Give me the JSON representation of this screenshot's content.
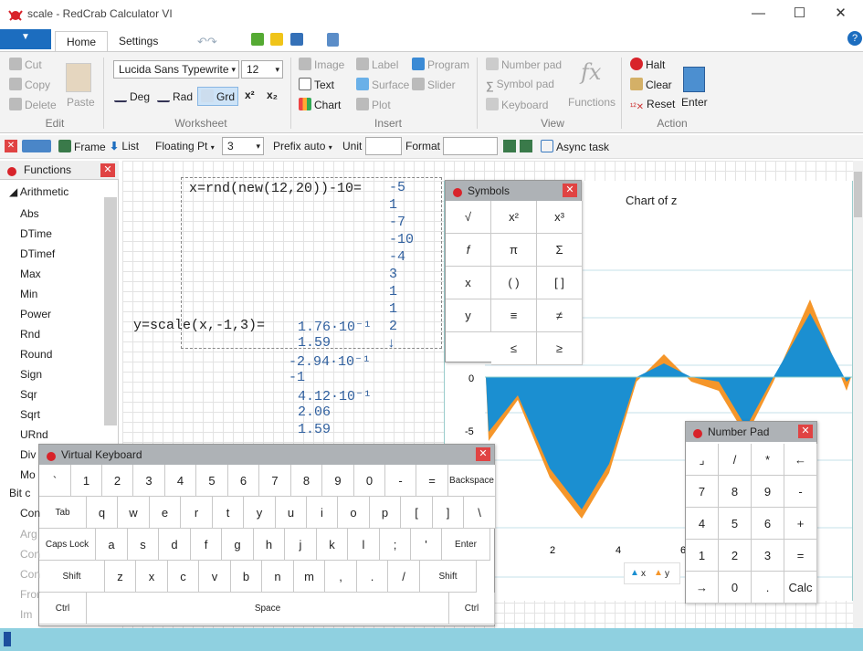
{
  "window": {
    "title": "scale - RedCrab Calculator VI"
  },
  "tabs": [
    "Home",
    "Settings"
  ],
  "ribbon": {
    "clipboard": {
      "cut": "Cut",
      "copy": "Copy",
      "delete": "Delete",
      "paste": "Paste",
      "group": "Edit"
    },
    "worksheet": {
      "font": "Lucida Sans Typewrite",
      "size": "12",
      "deg": "Deg",
      "rad": "Rad",
      "grd": "Grd",
      "group": "Worksheet"
    },
    "insert": {
      "image": "Image",
      "label": "Label",
      "program": "Program",
      "text": "Text",
      "surface": "Surface",
      "slider": "Slider",
      "chart": "Chart",
      "plot": "Plot",
      "group": "Insert"
    },
    "view": {
      "numberpad": "Number pad",
      "symbolpad": "Symbol pad",
      "keyboard": "Keyboard",
      "functions": "Functions",
      "group": "View"
    },
    "action": {
      "halt": "Halt",
      "clear": "Clear",
      "reset": "Reset",
      "enter": "Enter",
      "group": "Action"
    }
  },
  "toolbar": {
    "frame": "Frame",
    "list": "List",
    "float": "Floating Pt",
    "digits": "3",
    "prefix": "Prefix auto",
    "unit": "Unit",
    "format": "Format",
    "async": "Async task"
  },
  "functions": {
    "title": "Functions",
    "category": "Arithmetic",
    "items": [
      "Abs",
      "DTime",
      "DTimef",
      "Max",
      "Min",
      "Power",
      "Rnd",
      "Round",
      "Sign",
      "Sqr",
      "Sqrt",
      "URnd",
      "Div",
      "Mo"
    ],
    "other": [
      "Bit c",
      "Con",
      "Arg",
      "Con",
      "Con",
      "Fror",
      "Im"
    ]
  },
  "sheet": {
    "expr1": "x=rnd(new(12,20))-10=",
    "xvals": [
      "-5",
      "1",
      "-7",
      "-10",
      "-4",
      "3",
      "1",
      "1",
      "2",
      "↓"
    ],
    "expr2": "y=scale(x,-1,3)=",
    "yvals": [
      "1.76·10⁻¹",
      "1.59",
      "-2.94·10⁻¹",
      "-1",
      "4.12·10⁻¹",
      "2.06",
      "1.59"
    ]
  },
  "symbols": {
    "title": "Symbols",
    "keys": [
      "√",
      "x²",
      "x³",
      "f",
      "π",
      "Σ",
      "x",
      "( )",
      "[ ]",
      "y",
      "≡",
      "≠",
      "≤",
      "≥"
    ]
  },
  "chart": {
    "title": "Chart of z",
    "yticks": [
      "0",
      "-5"
    ],
    "xticks": [
      "2",
      "4",
      "6"
    ],
    "legend": [
      "x",
      "y"
    ]
  },
  "keyboard": {
    "title": "Virtual Keyboard",
    "row1": [
      "`",
      "1",
      "2",
      "3",
      "4",
      "5",
      "6",
      "7",
      "8",
      "9",
      "0",
      "-",
      "=",
      "Backspace"
    ],
    "row2": [
      "Tab",
      "q",
      "w",
      "e",
      "r",
      "t",
      "y",
      "u",
      "i",
      "o",
      "p",
      "[",
      "]",
      "\\"
    ],
    "row3": [
      "Caps Lock",
      "a",
      "s",
      "d",
      "f",
      "g",
      "h",
      "j",
      "k",
      "l",
      ";",
      "'",
      "Enter"
    ],
    "row4": [
      "Shift",
      "z",
      "x",
      "c",
      "v",
      "b",
      "n",
      "m",
      ",",
      ".",
      "/",
      "Shift"
    ],
    "row5": [
      "Ctrl",
      "Space",
      "Ctrl"
    ]
  },
  "numpad": {
    "title": "Number Pad",
    "keys": [
      "⌟",
      "/",
      "*",
      "←",
      "7",
      "8",
      "9",
      "-",
      "4",
      "5",
      "6",
      "+",
      "1",
      "2",
      "3",
      "=",
      "→",
      "0",
      ".",
      "Calc"
    ]
  },
  "colors": {
    "accent": "#1c6dbf",
    "chartBlue": "#1b8fd1",
    "chartOrange": "#f5962a",
    "status": "#8fd0e0"
  }
}
